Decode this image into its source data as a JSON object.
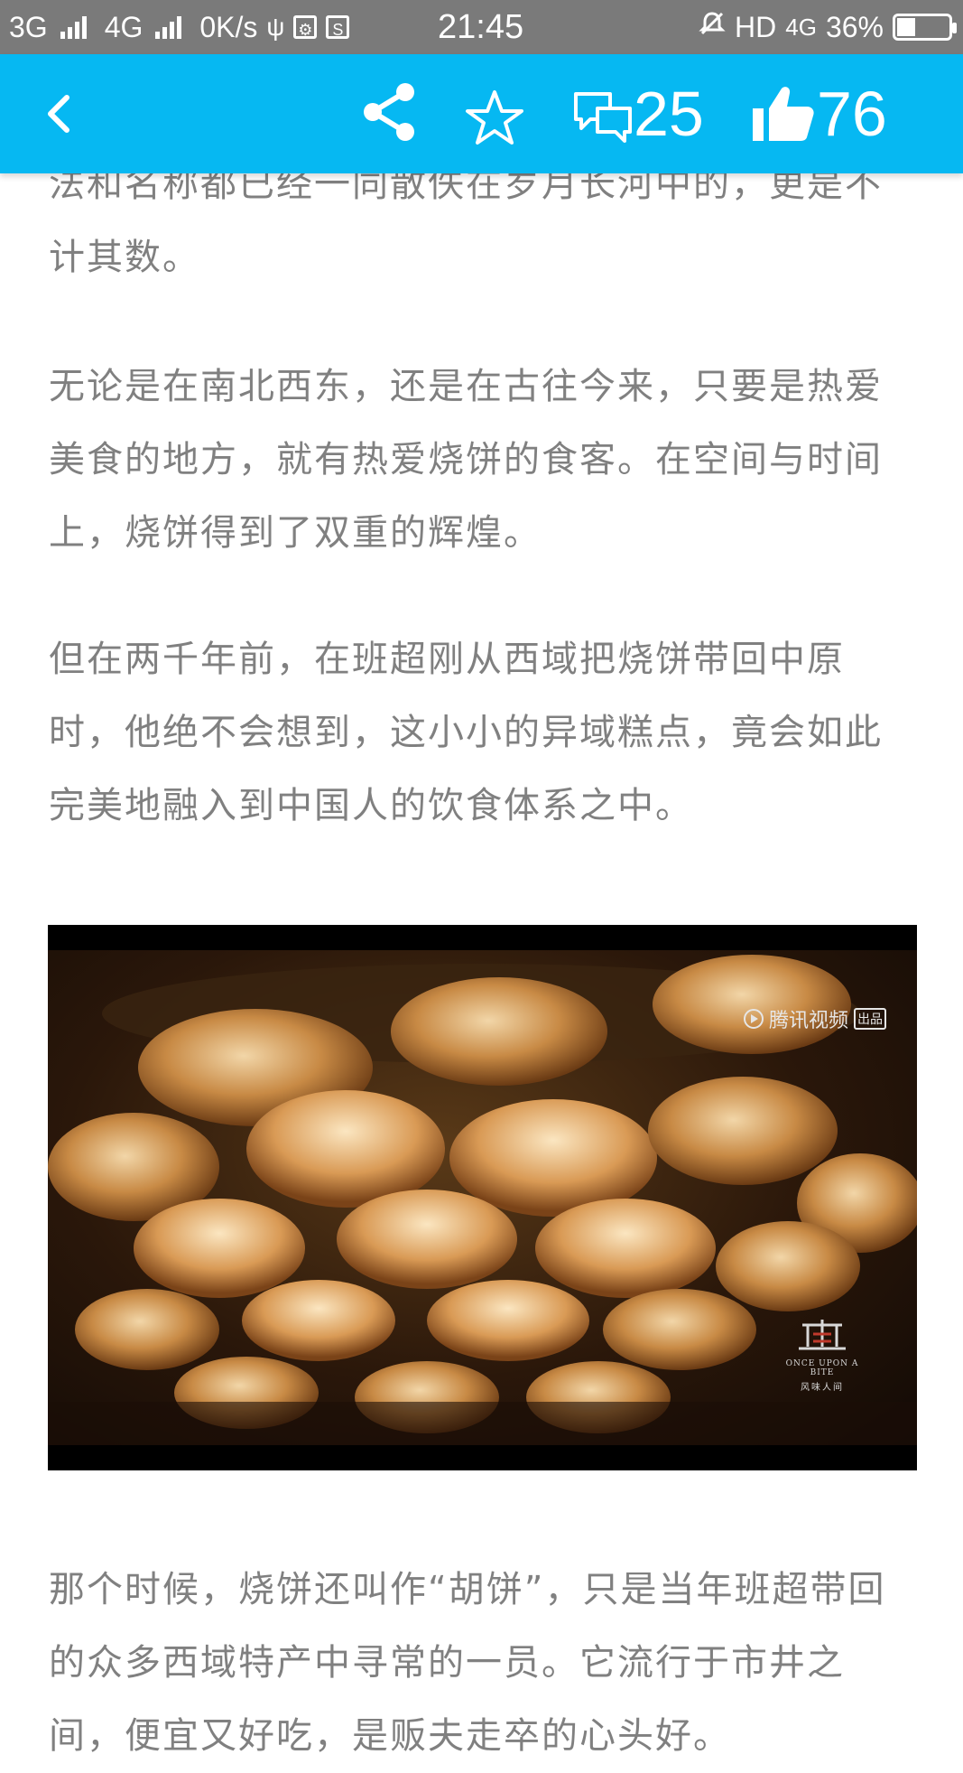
{
  "status_bar": {
    "network_1": "3G",
    "network_2": "4G",
    "speed": "0K/s",
    "time": "21:45",
    "hd": "HD",
    "network_3": "4G",
    "battery": "36%"
  },
  "toolbar": {
    "comment_count": "25",
    "like_count": "76"
  },
  "article": {
    "paragraphs": [
      "法和名称都已经一同散佚在岁月长河中的，更是不计其数。",
      "无论是在南北西东，还是在古往今来，只要是热爱美食的地方，就有热爱烧饼的食客。在空间与时间上，烧饼得到了双重的辉煌。",
      "但在两千年前，在班超刚从西域把烧饼带回中原时，他绝不会想到，这小小的异域糕点，竟会如此完美地融入到中国人的饮食体系之中。",
      "那个时候，烧饼还叫作“胡饼”，只是当年班超带回的众多西域特产中寻常的一员。它流行于市井之间，便宜又好吃，是贩夫走卒的心头好。"
    ],
    "image": {
      "watermark": "腾讯视频",
      "watermark_tag": "出品",
      "brand_line_1": "ONCE UPON A BITE",
      "brand_line_2": "风味人间"
    }
  }
}
